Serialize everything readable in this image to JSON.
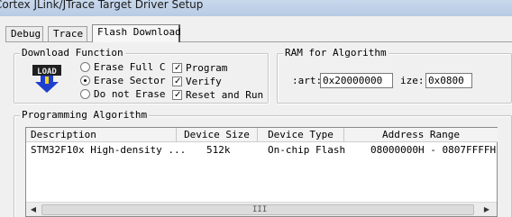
{
  "window": {
    "title": "Cortex JLink/JTrace Target Driver Setup"
  },
  "tabs": [
    {
      "label": "Debug"
    },
    {
      "label": "Trace"
    },
    {
      "label": "Flash Download"
    }
  ],
  "download_function": {
    "group_label": "Download Function",
    "icon_text": "LOAD",
    "erase_full": "Erase Full C",
    "erase_sector": "Erase Sector",
    "do_not_erase": "Do not Erase",
    "program": "Program",
    "verify": "Verify",
    "reset_and_run": "Reset and Run",
    "selected_erase": "Erase Sector"
  },
  "ram_for_algorithm": {
    "group_label": "RAM for Algorithm",
    "start_label": ":art:",
    "start_value": "0x20000000",
    "size_label": "ize:",
    "size_value": "0x0800"
  },
  "programming_algorithm": {
    "group_label": "Programming Algorithm",
    "columns": [
      "Description",
      "Device Size",
      "Device Type",
      "Address Range"
    ],
    "rows": [
      {
        "description": "STM32F10x High-density ...",
        "size": "512k",
        "type": "On-chip Flash",
        "range": "08000000H - 0807FFFFH"
      }
    ],
    "scroll_grip": "III"
  },
  "colors": {
    "icon_arrow": "#1f3fcf",
    "icon_text": "#e8e8e8"
  }
}
